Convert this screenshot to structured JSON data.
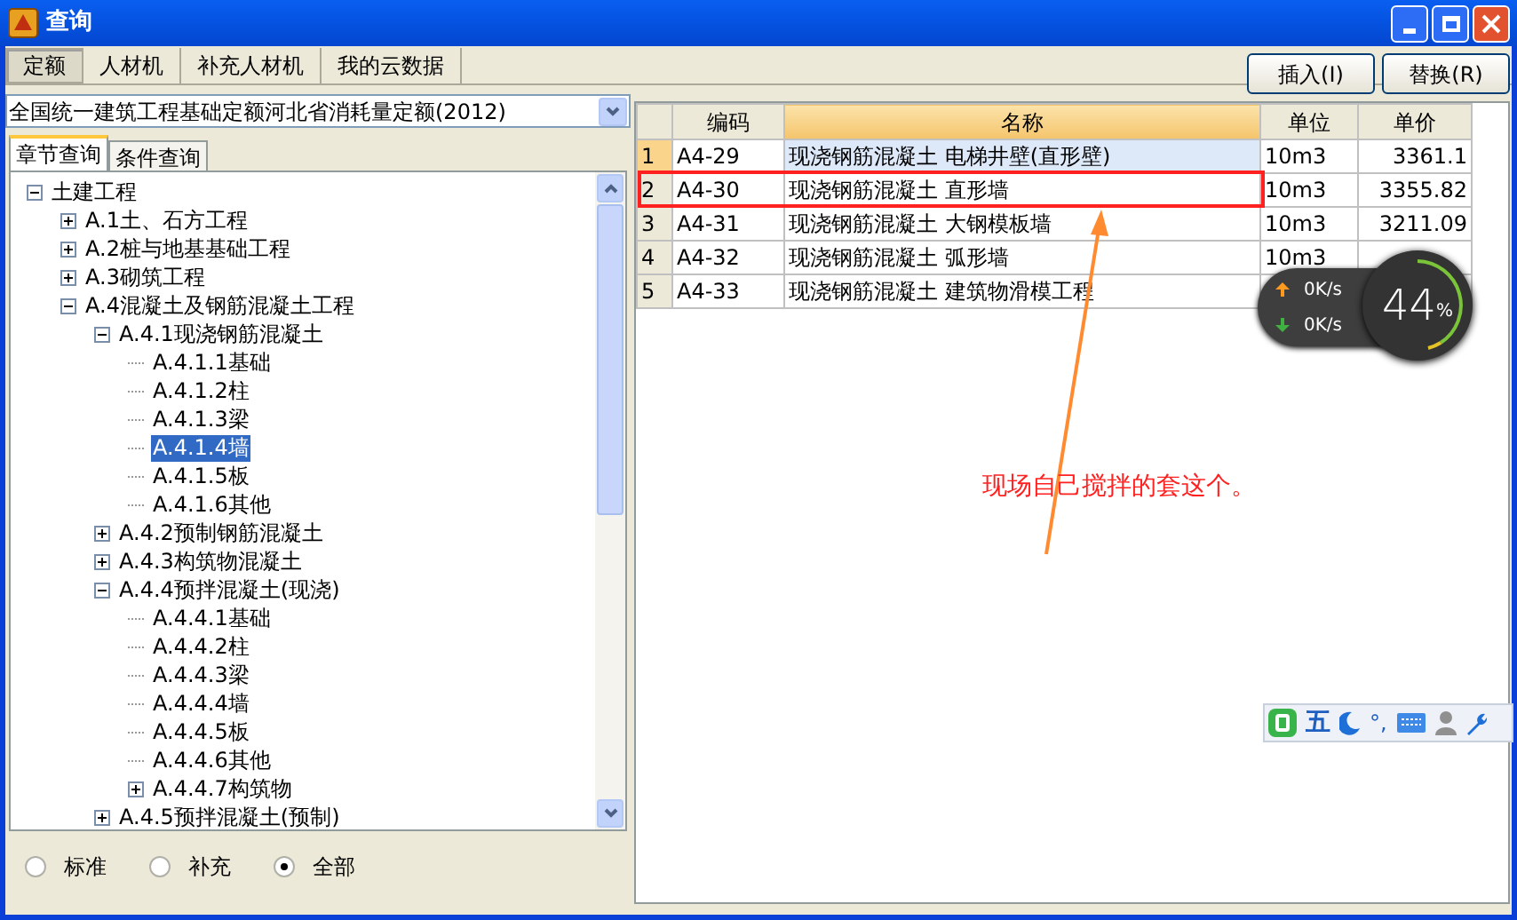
{
  "window": {
    "title": "查询"
  },
  "tabs": [
    {
      "label": "定额",
      "selected": true
    },
    {
      "label": "人材机",
      "selected": false
    },
    {
      "label": "补充人材机",
      "selected": false
    },
    {
      "label": "我的云数据",
      "selected": false
    }
  ],
  "quota_select": {
    "value": "全国统一建筑工程基础定额河北省消耗量定额(2012)"
  },
  "search_tabs": [
    {
      "label": "章节查询",
      "selected": true
    },
    {
      "label": "条件查询",
      "selected": false
    }
  ],
  "tree": [
    {
      "kind": "folder",
      "label": "土建工程",
      "expanded": true,
      "selected": false,
      "children": [
        {
          "kind": "folder",
          "label": "A.1土、石方工程",
          "expanded": false,
          "selected": false
        },
        {
          "kind": "folder",
          "label": "A.2桩与地基基础工程",
          "expanded": false,
          "selected": false
        },
        {
          "kind": "folder",
          "label": "A.3砌筑工程",
          "expanded": false,
          "selected": false
        },
        {
          "kind": "folder",
          "label": "A.4混凝土及钢筋混凝土工程",
          "expanded": true,
          "selected": false,
          "children": [
            {
              "kind": "folder",
              "label": "A.4.1现浇钢筋混凝土",
              "expanded": true,
              "selected": false,
              "children": [
                {
                  "kind": "leaf",
                  "label": "A.4.1.1基础",
                  "selected": false
                },
                {
                  "kind": "leaf",
                  "label": "A.4.1.2柱",
                  "selected": false
                },
                {
                  "kind": "leaf",
                  "label": "A.4.1.3梁",
                  "selected": false
                },
                {
                  "kind": "leaf",
                  "label": "A.4.1.4墙",
                  "selected": true
                },
                {
                  "kind": "leaf",
                  "label": "A.4.1.5板",
                  "selected": false
                },
                {
                  "kind": "leaf",
                  "label": "A.4.1.6其他",
                  "selected": false
                }
              ]
            },
            {
              "kind": "folder",
              "label": "A.4.2预制钢筋混凝土",
              "expanded": false,
              "selected": false
            },
            {
              "kind": "folder",
              "label": "A.4.3构筑物混凝土",
              "expanded": false,
              "selected": false
            },
            {
              "kind": "folder",
              "label": "A.4.4预拌混凝土(现浇)",
              "expanded": true,
              "selected": false,
              "children": [
                {
                  "kind": "leaf",
                  "label": "A.4.4.1基础",
                  "selected": false
                },
                {
                  "kind": "leaf",
                  "label": "A.4.4.2柱",
                  "selected": false
                },
                {
                  "kind": "leaf",
                  "label": "A.4.4.3梁",
                  "selected": false
                },
                {
                  "kind": "leaf",
                  "label": "A.4.4.4墙",
                  "selected": false
                },
                {
                  "kind": "leaf",
                  "label": "A.4.4.5板",
                  "selected": false
                },
                {
                  "kind": "leaf",
                  "label": "A.4.4.6其他",
                  "selected": false
                },
                {
                  "kind": "folder",
                  "label": "A.4.4.7构筑物",
                  "expanded": false,
                  "selected": false
                }
              ]
            },
            {
              "kind": "folder",
              "label": "A.4.5预拌混凝土(预制)",
              "expanded": false,
              "selected": false
            }
          ]
        }
      ]
    }
  ],
  "filter": [
    {
      "label": "标准",
      "selected": false
    },
    {
      "label": "补充",
      "selected": false
    },
    {
      "label": "全部",
      "selected": true
    }
  ],
  "buttons": [
    "插入(I)",
    "替换(R)"
  ],
  "table": {
    "columns": [
      "编码",
      "名称",
      "单位",
      "单价"
    ],
    "rows": [
      {
        "index": "1",
        "code": "A4-29",
        "name": "现浇钢筋混凝土 电梯井壁(直形壁)",
        "unit": "10m3",
        "price": "3361.1",
        "selected": true
      },
      {
        "index": "2",
        "code": "A4-30",
        "name": "现浇钢筋混凝土 直形墙",
        "unit": "10m3",
        "price": "3355.82",
        "selected": false
      },
      {
        "index": "3",
        "code": "A4-31",
        "name": "现浇钢筋混凝土 大钢模板墙",
        "unit": "10m3",
        "price": "3211.09",
        "selected": false
      },
      {
        "index": "4",
        "code": "A4-32",
        "name": "现浇钢筋混凝土 弧形墙",
        "unit": "10m3",
        "price": "",
        "selected": false
      },
      {
        "index": "5",
        "code": "A4-33",
        "name": "现浇钢筋混凝土 建筑物滑模工程",
        "unit": "",
        "price": "",
        "selected": false
      }
    ]
  },
  "annotation": {
    "text": "现场自己搅拌的套这个。"
  },
  "net_widget": {
    "upload": "0K/s",
    "download": "0K/s",
    "percent": "44",
    "unit": "%"
  },
  "ime_toolbar": {
    "mode": "五",
    "punct": "°,"
  }
}
